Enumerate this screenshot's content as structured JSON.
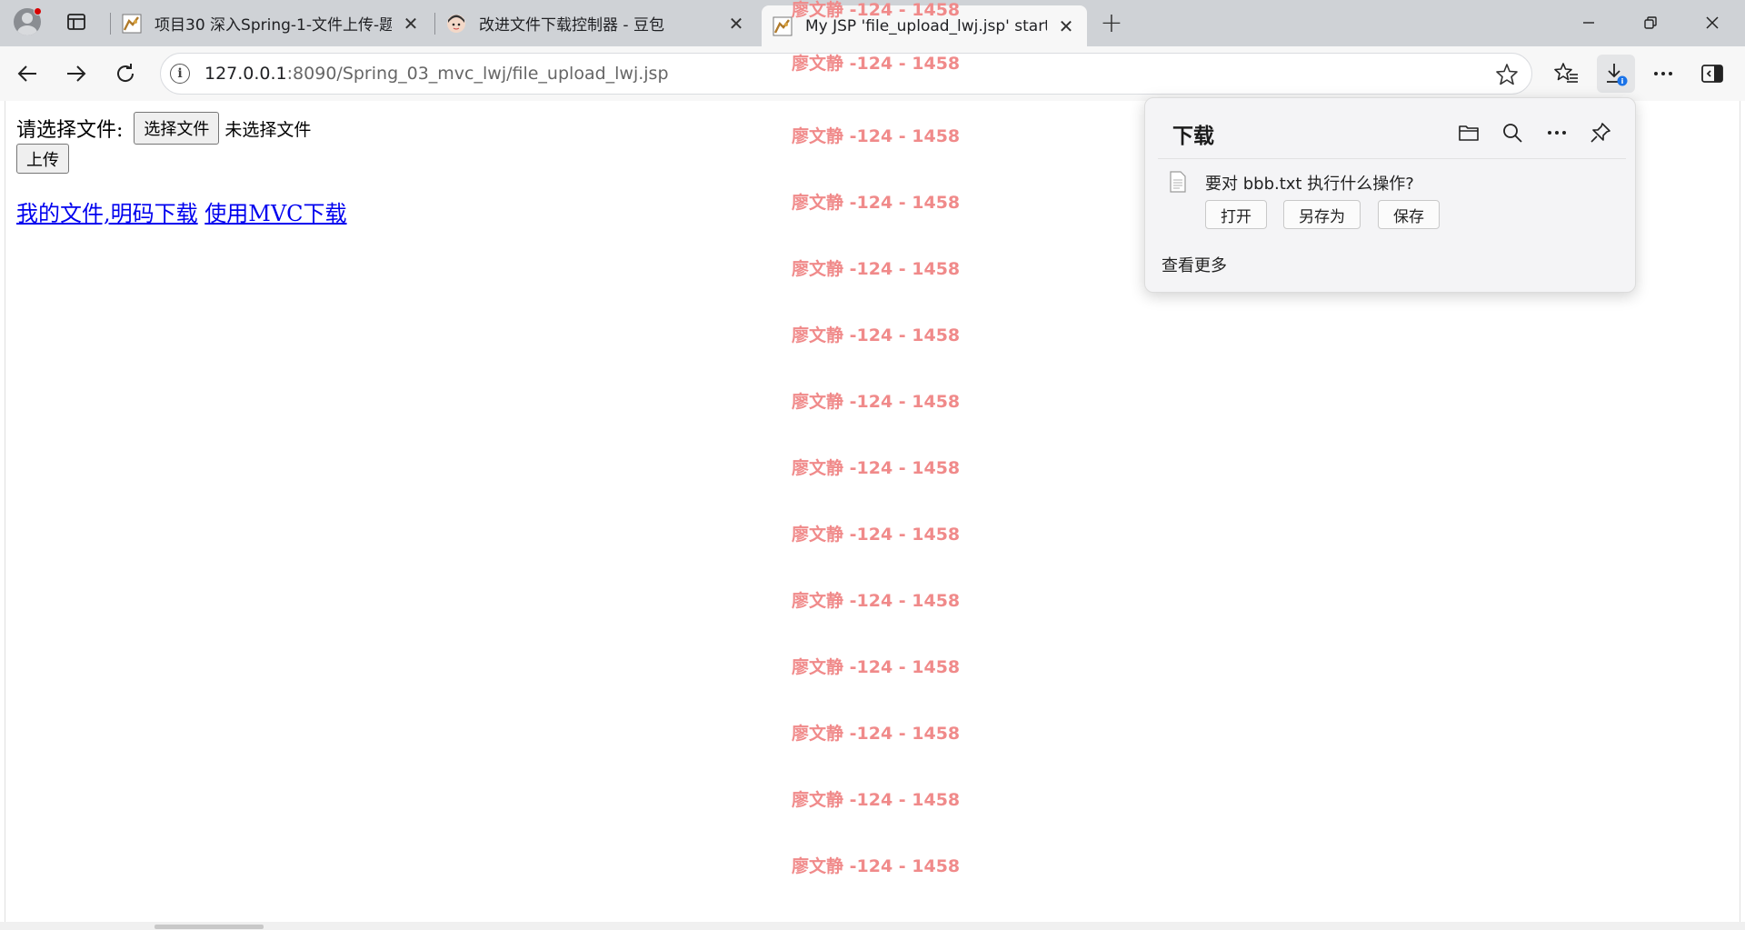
{
  "browser": {
    "tabs": [
      {
        "title": "项目30 深入Spring-1-文件上传-题",
        "favicon": "cat-icon",
        "active": false
      },
      {
        "title": "改进文件下载控制器 - 豆包",
        "favicon": "doubao-avatar-icon",
        "active": false
      },
      {
        "title": "My JSP 'file_upload_lwj.jsp' startin",
        "favicon": "cat-icon",
        "active": true
      }
    ],
    "address": {
      "host": "127.0.0.1",
      "rest": ":8090/Spring_03_mvc_lwj/file_upload_lwj.jsp"
    }
  },
  "page": {
    "choose_label": "请选择文件:",
    "choose_button": "选择文件",
    "no_file": "未选择文件",
    "upload_button": "上传",
    "link1": "我的文件,明码下载",
    "link2": "使用MVC下载",
    "watermark": "廖文静 -124 - 1458"
  },
  "downloads": {
    "title": "下载",
    "question": "要对 bbb.txt 执行什么操作?",
    "open": "打开",
    "save_as": "另存为",
    "save": "保存",
    "see_more": "查看更多"
  },
  "colors": {
    "watermark": "#f08a8a",
    "link": "#0000ee",
    "tabbar": "#cfd2d6"
  }
}
